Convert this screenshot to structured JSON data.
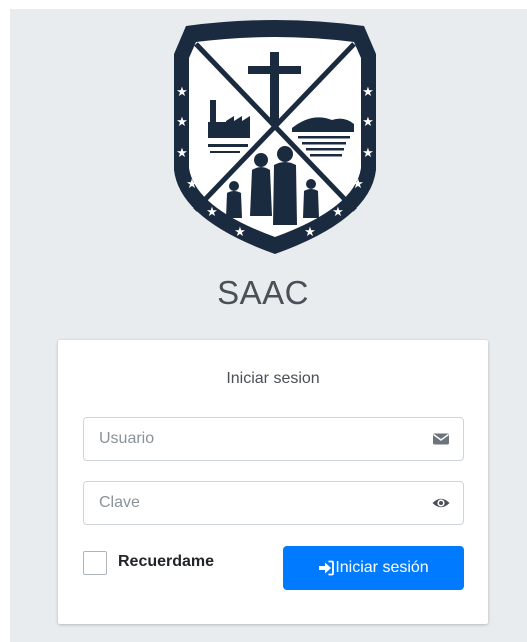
{
  "app": {
    "title": "SAAC"
  },
  "login_card": {
    "message": "Iniciar sesion",
    "username": {
      "placeholder": "Usuario",
      "value": "",
      "icon": "envelope-icon"
    },
    "password": {
      "placeholder": "Clave",
      "value": "",
      "icon": "eye-icon"
    },
    "remember": {
      "label": "Recuerdame",
      "checked": false
    },
    "submit": {
      "label": "Iniciar sesión",
      "icon": "sign-in-icon"
    }
  },
  "colors": {
    "page_background": "#e9ecef",
    "primary": "#007bff",
    "logo_navy": "#1b2b3f"
  }
}
